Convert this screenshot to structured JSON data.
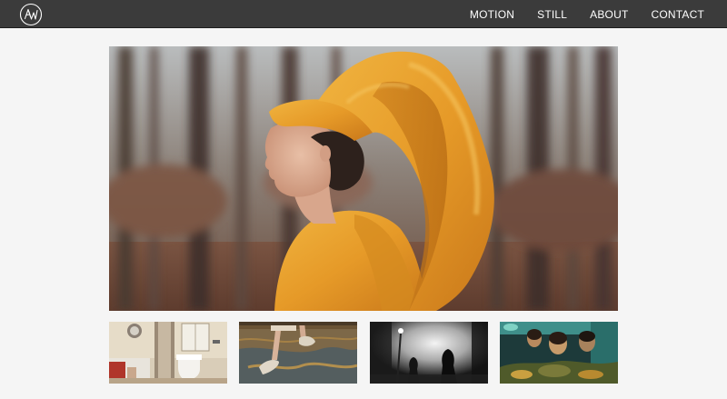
{
  "header": {
    "logo_text": "AW",
    "nav": [
      {
        "label": "MOTION"
      },
      {
        "label": "STILL"
      },
      {
        "label": "ABOUT"
      },
      {
        "label": "CONTACT"
      }
    ]
  },
  "gallery": {
    "featured": {
      "subject": "woman-in-orange-head-wrap-forest"
    },
    "thumbnails": [
      {
        "subject": "bathroom-interior"
      },
      {
        "subject": "feet-on-patterned-rug"
      },
      {
        "subject": "silhouettes-in-smoke"
      },
      {
        "subject": "faces-behind-aquarium"
      }
    ]
  },
  "colors": {
    "nav_bg": "#3b3b3b",
    "page_bg": "#f5f5f5",
    "nav_text": "#ffffff",
    "wrap_orange": "#e79b2b"
  }
}
